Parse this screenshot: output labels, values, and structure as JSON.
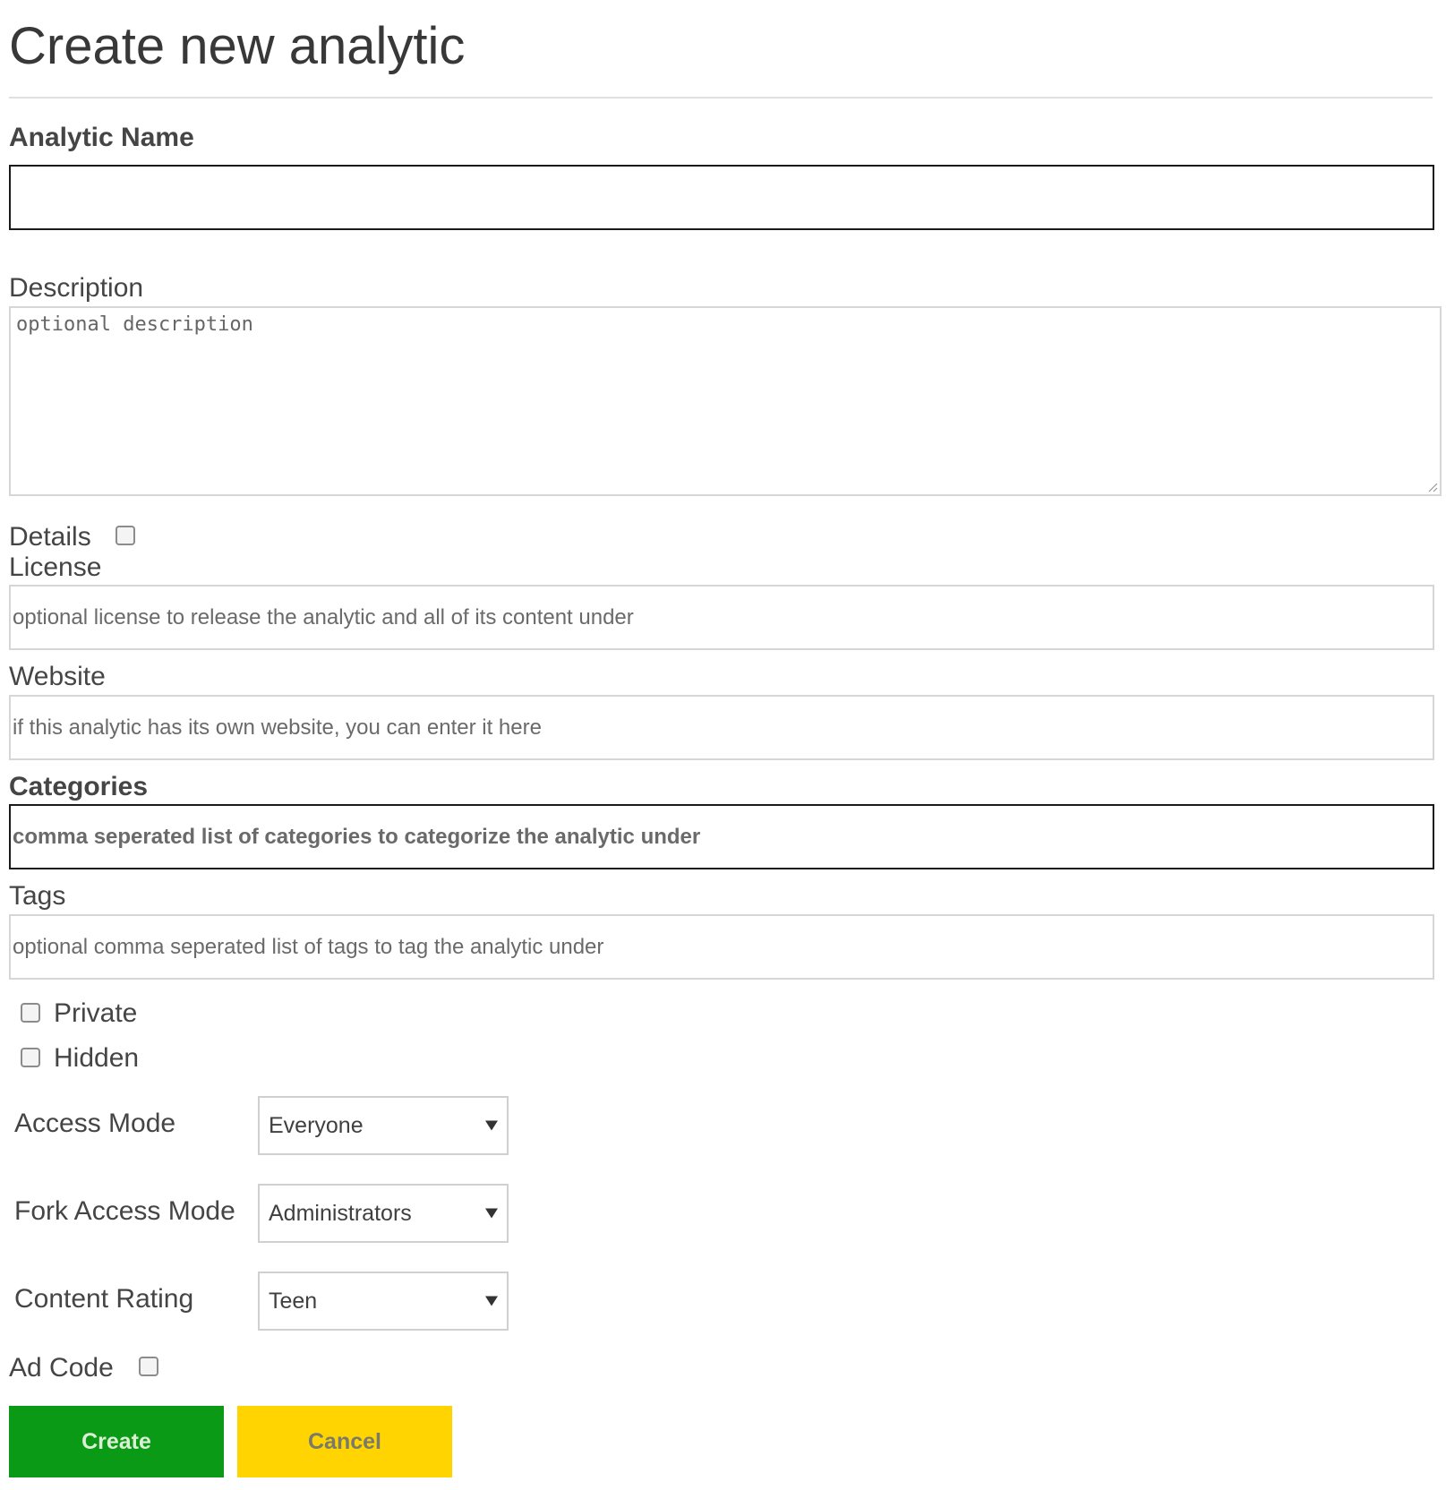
{
  "page": {
    "title": "Create new analytic"
  },
  "fields": {
    "name": {
      "label": "Analytic Name",
      "value": ""
    },
    "description": {
      "label": "Description",
      "placeholder": "optional description"
    },
    "details": {
      "label": "Details",
      "checked": false
    },
    "license": {
      "label": "License",
      "placeholder": "optional license to release the analytic and all of its content under"
    },
    "website": {
      "label": "Website",
      "placeholder": "if this analytic has its own website, you can enter it here"
    },
    "categories": {
      "label": "Categories",
      "placeholder": "comma seperated list of categories to categorize the analytic under"
    },
    "tags": {
      "label": "Tags",
      "placeholder": "optional comma seperated list of tags to tag the analytic under"
    },
    "private": {
      "label": "Private",
      "checked": false
    },
    "hidden": {
      "label": "Hidden",
      "checked": false
    },
    "access_mode": {
      "label": "Access Mode",
      "value": "Everyone"
    },
    "fork_access_mode": {
      "label": "Fork Access Mode",
      "value": "Administrators"
    },
    "content_rating": {
      "label": "Content Rating",
      "value": "Teen"
    },
    "ad_code": {
      "label": "Ad Code",
      "checked": false
    }
  },
  "buttons": {
    "create": "Create",
    "cancel": "Cancel"
  },
  "colors": {
    "create_bg": "#0b9a15",
    "cancel_bg": "#ffd400"
  }
}
